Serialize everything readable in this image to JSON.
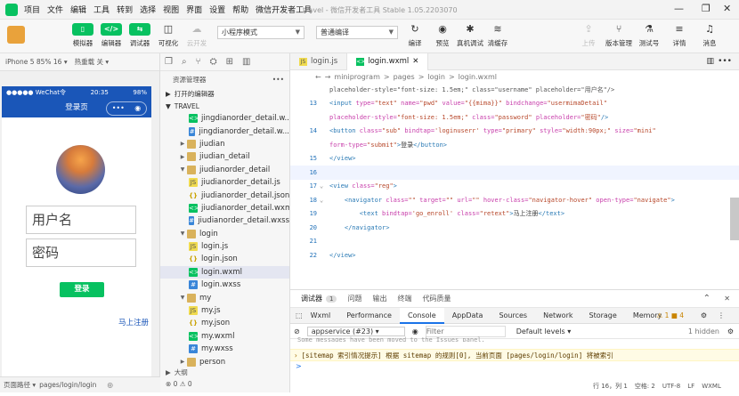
{
  "menubar": {
    "items": [
      "项目",
      "文件",
      "编辑",
      "工具",
      "转到",
      "选择",
      "视图",
      "界面",
      "设置",
      "帮助",
      "微信开发者工具"
    ],
    "window_title": "travel - 微信开发者工具 Stable 1.05.2203070"
  },
  "toolbar": {
    "left_buttons": [
      {
        "icon": "phone-icon",
        "label": "模拟器"
      },
      {
        "icon": "code-icon",
        "label": "编辑器"
      },
      {
        "icon": "debug-icon",
        "label": "调试器"
      },
      {
        "icon": "visual-icon",
        "label": "可视化"
      },
      {
        "icon": "cloud-icon",
        "label": "云开发"
      }
    ],
    "mode_select": "小程序模式",
    "compile_select": "普通编译",
    "mid_buttons": [
      {
        "icon": "refresh-icon",
        "label": "编译"
      },
      {
        "icon": "eye-icon",
        "label": "预览"
      },
      {
        "icon": "bug-icon",
        "label": "真机调试"
      },
      {
        "icon": "layers-icon",
        "label": "清缓存"
      }
    ],
    "right_buttons": [
      {
        "icon": "upload-icon",
        "label": "上传"
      },
      {
        "icon": "branch-icon",
        "label": "版本管理"
      },
      {
        "icon": "test-icon",
        "label": "测试号"
      },
      {
        "icon": "details-icon",
        "label": "详情"
      },
      {
        "icon": "bell-icon",
        "label": "消息"
      }
    ]
  },
  "simulator": {
    "device": "iPhone 5 85% 16 ▾",
    "hotreload": "热重载 关 ▾",
    "status_left": "●●●●● WeChat令",
    "status_time": "20:35",
    "status_right": "98%",
    "nav_title": "登录页",
    "username_placeholder": "用户名",
    "password_placeholder": "密码",
    "login_button": "登录",
    "register_link": "马上注册",
    "footer_path_label": "页面路径 ▾",
    "footer_path": "pages/login/login"
  },
  "explorer": {
    "title": "资源管理器",
    "open_editors": "打开的编辑器",
    "project": "TRAVEL",
    "items": [
      {
        "name": "jingdianorder_detail.w...",
        "type": "wxml",
        "indent": 2
      },
      {
        "name": "jingdianorder_detail.w...",
        "type": "wxss",
        "indent": 2
      },
      {
        "name": "jiudian",
        "type": "folder",
        "indent": 1,
        "arrow": "▶"
      },
      {
        "name": "jiudian_detail",
        "type": "folder",
        "indent": 1,
        "arrow": "▶"
      },
      {
        "name": "jiudianorder_detail",
        "type": "folder",
        "indent": 1,
        "arrow": "▼"
      },
      {
        "name": "jiudianorder_detail.js",
        "type": "js",
        "indent": 2
      },
      {
        "name": "jiudianorder_detail.json",
        "type": "json",
        "indent": 2
      },
      {
        "name": "jiudianorder_detail.wxml",
        "type": "wxml",
        "indent": 2
      },
      {
        "name": "jiudianorder_detail.wxss",
        "type": "wxss",
        "indent": 2
      },
      {
        "name": "login",
        "type": "folder",
        "indent": 1,
        "arrow": "▼"
      },
      {
        "name": "login.js",
        "type": "js",
        "indent": 2
      },
      {
        "name": "login.json",
        "type": "json",
        "indent": 2
      },
      {
        "name": "login.wxml",
        "type": "wxml",
        "indent": 2,
        "active": true
      },
      {
        "name": "login.wxss",
        "type": "wxss",
        "indent": 2
      },
      {
        "name": "my",
        "type": "folder",
        "indent": 1,
        "arrow": "▼"
      },
      {
        "name": "my.js",
        "type": "js",
        "indent": 2
      },
      {
        "name": "my.json",
        "type": "json",
        "indent": 2
      },
      {
        "name": "my.wxml",
        "type": "wxml",
        "indent": 2
      },
      {
        "name": "my.wxss",
        "type": "wxss",
        "indent": 2
      },
      {
        "name": "person",
        "type": "folder",
        "indent": 1,
        "arrow": "▶"
      }
    ],
    "outline": "大纲",
    "errors": "⊗ 0 ⚠ 0"
  },
  "editor": {
    "tabs": [
      {
        "label": "login.js",
        "type": "js"
      },
      {
        "label": "login.wxml",
        "type": "wxml",
        "active": true
      }
    ],
    "breadcrumb": [
      "miniprogram",
      ">",
      "pages",
      ">",
      "login",
      ">",
      "login.wxml"
    ],
    "lines": [
      {
        "n": "",
        "t": [
          [
            "tok-plain",
            "placeholder-style=\"font-size: 1.5em;\" class=\"username\" placeholder=\"用户名\"/>"
          ]
        ]
      },
      {
        "n": "13",
        "t": [
          [
            "tok-tag",
            "<input "
          ],
          [
            "tok-attr",
            "type="
          ],
          [
            "tok-val",
            "\"text\" "
          ],
          [
            "tok-attr",
            "name="
          ],
          [
            "tok-val",
            "\"pwd\" "
          ],
          [
            "tok-attr",
            "value="
          ],
          [
            "tok-val",
            "\"{{mima}}\" "
          ],
          [
            "tok-attr",
            "bindchange="
          ],
          [
            "tok-val",
            "\"usermimaDetail\""
          ]
        ]
      },
      {
        "n": "",
        "t": [
          [
            "tok-attr",
            "placeholder-style="
          ],
          [
            "tok-val",
            "\"font-size: 1.5em;\" "
          ],
          [
            "tok-attr",
            "class="
          ],
          [
            "tok-val",
            "\"password\" "
          ],
          [
            "tok-attr",
            "placeholder="
          ],
          [
            "tok-val",
            "\"密码\""
          ],
          [
            "tok-tag",
            "/>"
          ]
        ]
      },
      {
        "n": "14",
        "t": [
          [
            "tok-tag",
            "<button "
          ],
          [
            "tok-attr",
            "class="
          ],
          [
            "tok-val",
            "\"sub\" "
          ],
          [
            "tok-attr",
            "bindtap="
          ],
          [
            "tok-val",
            "'loginuserr' "
          ],
          [
            "tok-attr",
            "type="
          ],
          [
            "tok-val",
            "\"primary\" "
          ],
          [
            "tok-attr",
            "style="
          ],
          [
            "tok-val",
            "\"width:90px;\" "
          ],
          [
            "tok-attr",
            "size="
          ],
          [
            "tok-val",
            "\"mini\""
          ]
        ]
      },
      {
        "n": "",
        "t": [
          [
            "tok-attr",
            "form-type="
          ],
          [
            "tok-val",
            "\"submit\""
          ],
          [
            "tok-tag",
            ">"
          ],
          [
            "tok-text",
            "登录"
          ],
          [
            "tok-tag",
            "</button>"
          ]
        ]
      },
      {
        "n": "15",
        "t": [
          [
            "tok-tag",
            "</view>"
          ]
        ]
      },
      {
        "n": "16",
        "t": [],
        "cur": true
      },
      {
        "n": "17",
        "fold": "⌄",
        "t": [
          [
            "tok-tag",
            "<view "
          ],
          [
            "tok-attr",
            "class="
          ],
          [
            "tok-val",
            "\"reg\""
          ],
          [
            "tok-tag",
            ">"
          ]
        ]
      },
      {
        "n": "18",
        "fold": "⌄",
        "t": [
          [
            "tok-plain",
            "    "
          ],
          [
            "tok-tag",
            "<navigator "
          ],
          [
            "tok-attr",
            "class="
          ],
          [
            "tok-val",
            "\"\" "
          ],
          [
            "tok-attr",
            "target="
          ],
          [
            "tok-val",
            "\"\" "
          ],
          [
            "tok-attr",
            "url="
          ],
          [
            "tok-val",
            "\"\" "
          ],
          [
            "tok-attr",
            "hover-class="
          ],
          [
            "tok-val",
            "\"navigator-hover\" "
          ],
          [
            "tok-attr",
            "open-type="
          ],
          [
            "tok-val",
            "\"navigate\""
          ],
          [
            "tok-tag",
            ">"
          ]
        ]
      },
      {
        "n": "19",
        "t": [
          [
            "tok-plain",
            "        "
          ],
          [
            "tok-tag",
            "<text "
          ],
          [
            "tok-attr",
            "bindtap="
          ],
          [
            "tok-val",
            "'go_enroll' "
          ],
          [
            "tok-attr",
            "class="
          ],
          [
            "tok-val",
            "\"retext\""
          ],
          [
            "tok-tag",
            ">"
          ],
          [
            "tok-text",
            "马上注册"
          ],
          [
            "tok-tag",
            "</text>"
          ]
        ]
      },
      {
        "n": "20",
        "t": [
          [
            "tok-plain",
            "    "
          ],
          [
            "tok-tag",
            "</navigator>"
          ]
        ]
      },
      {
        "n": "21",
        "t": []
      },
      {
        "n": "22",
        "t": [
          [
            "tok-tag",
            "</view>"
          ]
        ]
      }
    ]
  },
  "devtools": {
    "tabs1": [
      "调试器",
      "1",
      "问题",
      "输出",
      "终端",
      "代码质量"
    ],
    "tabs2": [
      "Wxml",
      "Performance",
      "Console",
      "AppData",
      "Sources",
      "Network",
      "Storage",
      "Memory"
    ],
    "active_tab2": "Console",
    "badges": "⚠ 1  ■ 4",
    "context": "appservice (#23)",
    "filter_placeholder": "Filter",
    "levels": "Default levels ▾",
    "hidden": "1 hidden",
    "warning": "[sitemap 索引情况提示] 根据 sitemap 的规则[0], 当前页面 [pages/login/login] 将被索引",
    "cut_line": "Some messages have been moved to the Issues panel.",
    "prompt": ">"
  },
  "statusbar": {
    "pos": "行 16，列 1",
    "spaces": "空格: 2",
    "enc": "UTF-8",
    "eol": "LF",
    "lang": "WXML"
  }
}
